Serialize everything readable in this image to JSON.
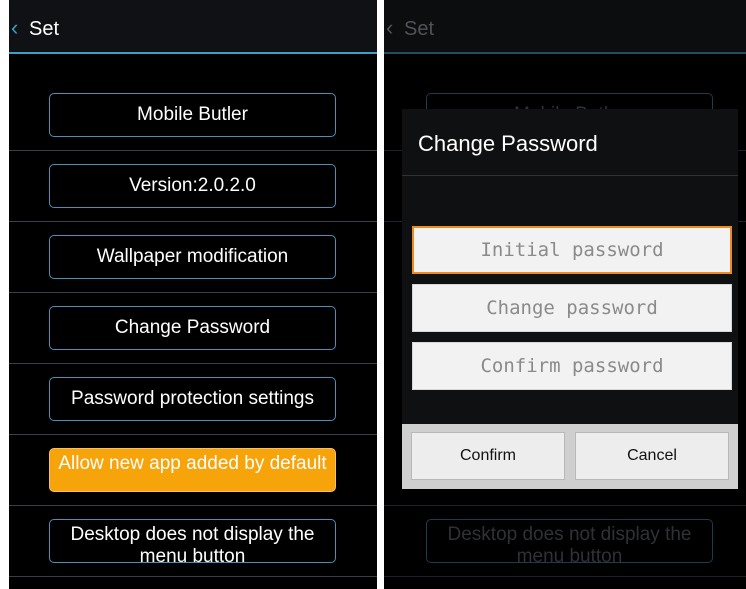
{
  "header": {
    "title": "Set"
  },
  "settings": [
    {
      "label": "Mobile Butler"
    },
    {
      "label": "Version:2.0.2.0"
    },
    {
      "label": "Wallpaper modification"
    },
    {
      "label": "Change Password"
    },
    {
      "label": "Password protection settings"
    },
    {
      "label": "Allow new app added by default",
      "highlighted": true
    },
    {
      "label": "Desktop does not display the menu button"
    }
  ],
  "dialog": {
    "title": "Change Password",
    "initial_placeholder": "Initial password",
    "change_placeholder": "Change password",
    "confirm_placeholder": "Confirm password",
    "confirm_label": "Confirm",
    "cancel_label": "Cancel"
  },
  "colors": {
    "accent": "#3aa0c8",
    "highlight": "#f7a30a",
    "focus": "#f08a1d"
  }
}
